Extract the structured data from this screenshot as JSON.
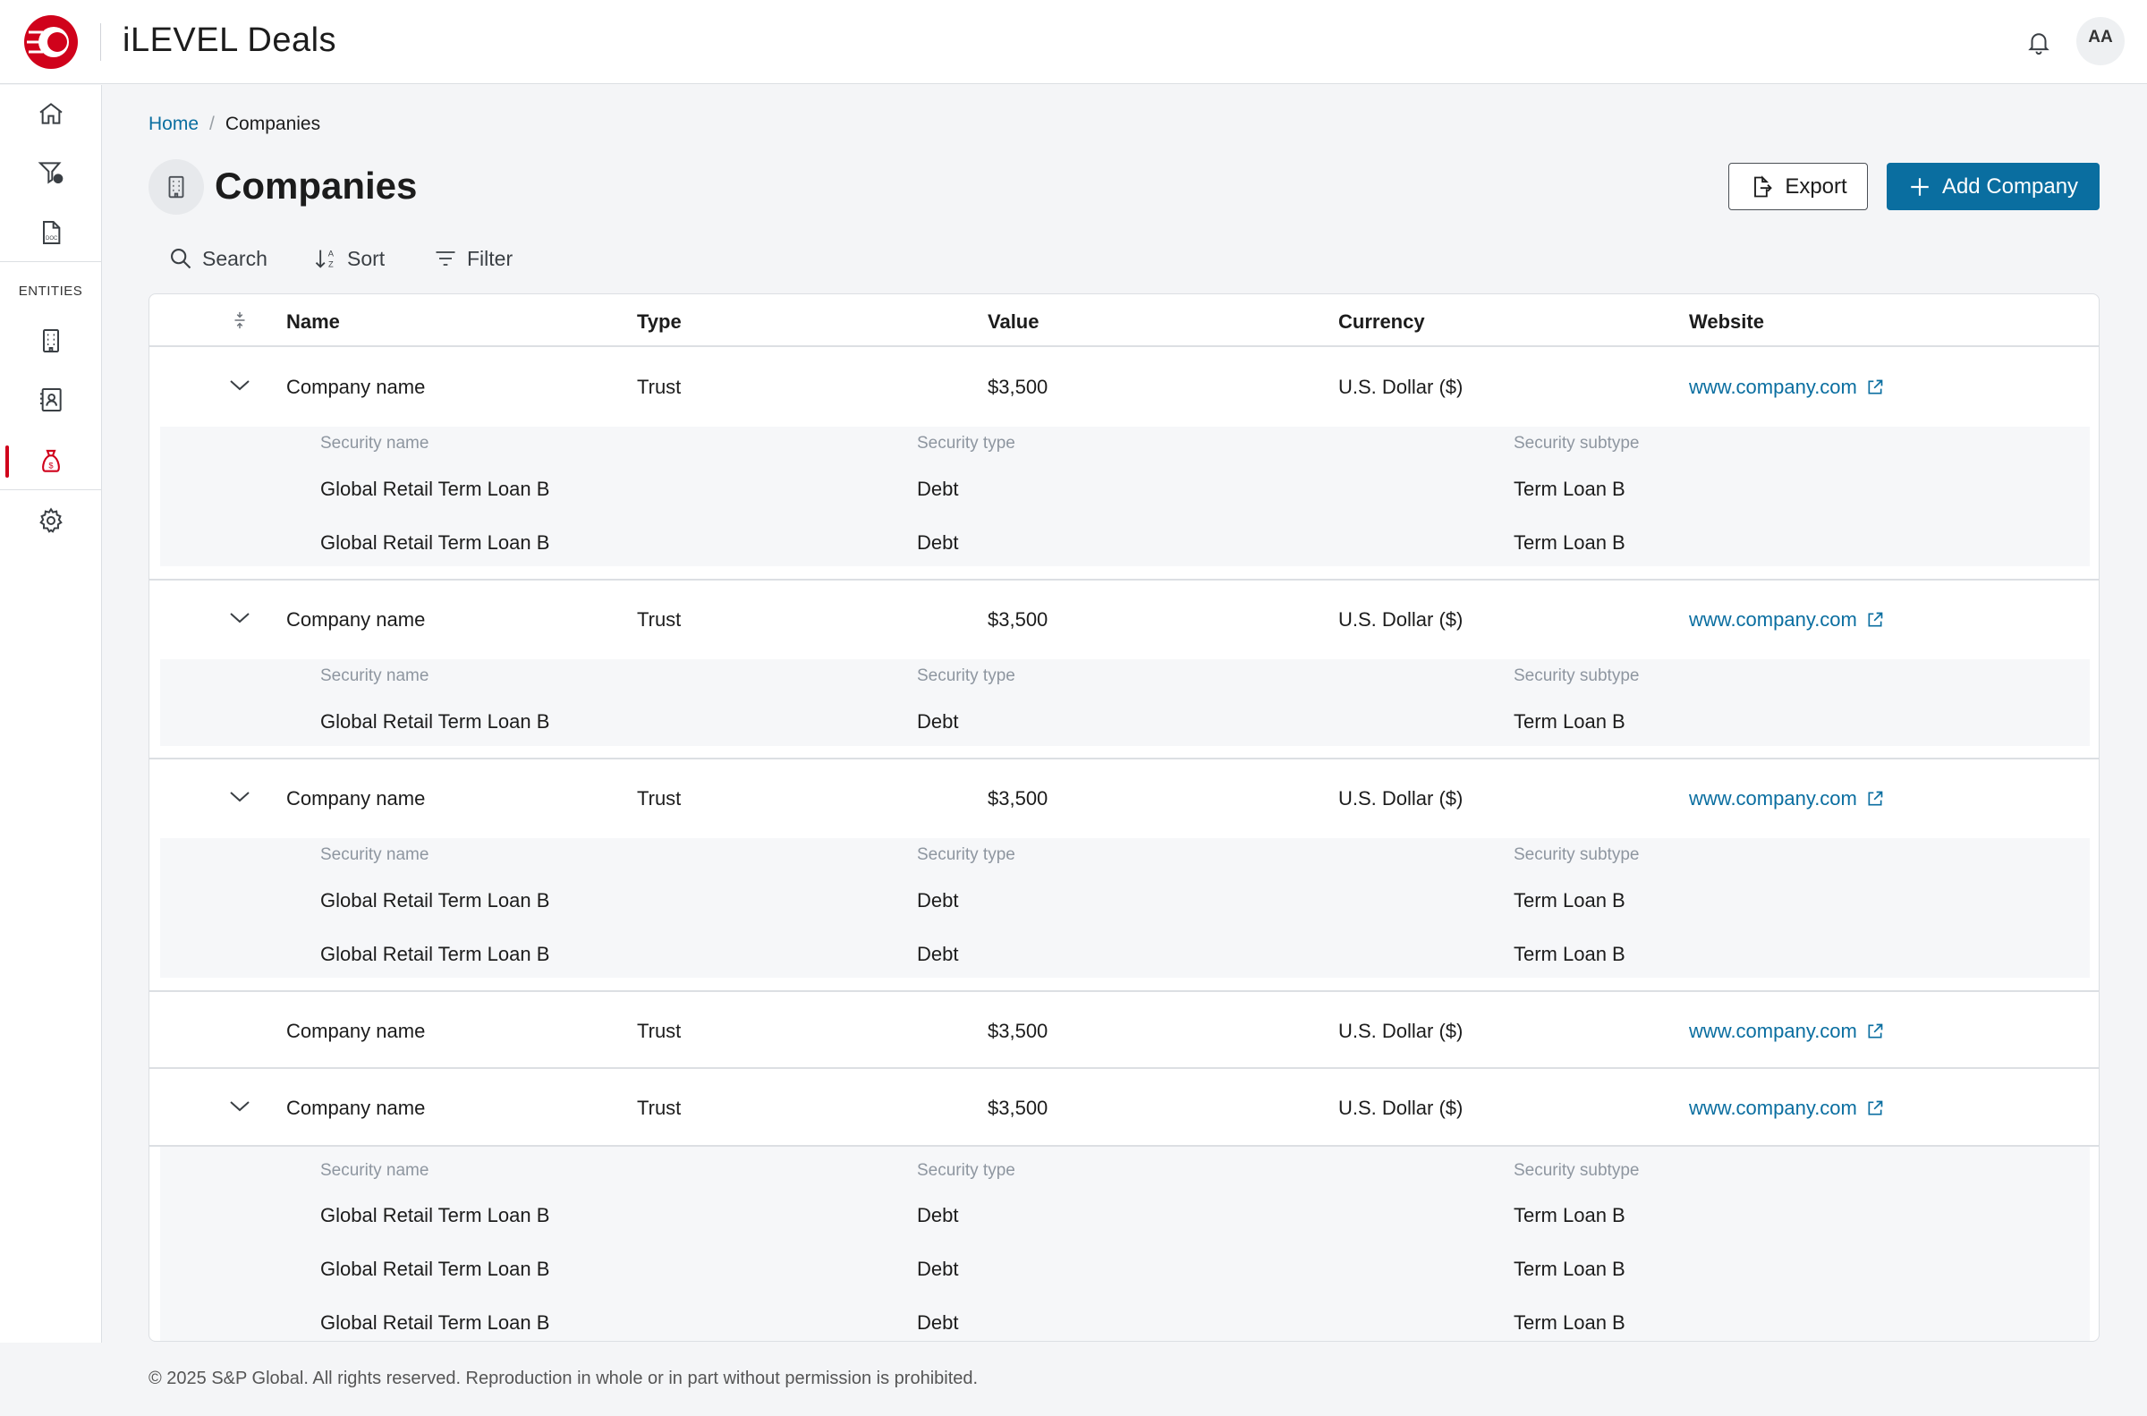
{
  "app": {
    "title": "iLEVEL Deals",
    "avatar_initials": "AA"
  },
  "sidebar": {
    "section_label": "ENTITIES"
  },
  "breadcrumb": {
    "home": "Home",
    "separator": "/",
    "current": "Companies"
  },
  "page": {
    "title": "Companies"
  },
  "actions": {
    "export_label": "Export",
    "add_label": "Add Company"
  },
  "toolbar": {
    "search_label": "Search",
    "sort_label": "Sort",
    "filter_label": "Filter"
  },
  "table": {
    "columns": [
      "Name",
      "Type",
      "Value",
      "Currency",
      "Website"
    ],
    "sub_columns": [
      "Security name",
      "Security type",
      "Security subtype"
    ],
    "rows": [
      {
        "name": "Company name",
        "type": "Trust",
        "value": "$3,500",
        "currency": "U.S. Dollar ($)",
        "website": "www.company.com",
        "securities": [
          {
            "name": "Global Retail Term Loan B",
            "type": "Debt",
            "subtype": "Term Loan B"
          },
          {
            "name": "Global Retail Term Loan B",
            "type": "Debt",
            "subtype": "Term Loan B"
          }
        ]
      },
      {
        "name": "Company name",
        "type": "Trust",
        "value": "$3,500",
        "currency": "U.S. Dollar ($)",
        "website": "www.company.com",
        "securities": [
          {
            "name": "Global Retail Term Loan B",
            "type": "Debt",
            "subtype": "Term Loan B"
          }
        ]
      },
      {
        "name": "Company name",
        "type": "Trust",
        "value": "$3,500",
        "currency": "U.S. Dollar ($)",
        "website": "www.company.com",
        "securities": [
          {
            "name": "Global Retail Term Loan B",
            "type": "Debt",
            "subtype": "Term Loan B"
          },
          {
            "name": "Global Retail Term Loan B",
            "type": "Debt",
            "subtype": "Term Loan B"
          }
        ]
      },
      {
        "name": "Company name",
        "type": "Trust",
        "value": "$3,500",
        "currency": "U.S. Dollar ($)",
        "website": "www.company.com",
        "securities": []
      },
      {
        "name": "Company name",
        "type": "Trust",
        "value": "$3,500",
        "currency": "U.S. Dollar ($)",
        "website": "www.company.com",
        "securities": [
          {
            "name": "Global Retail Term Loan B",
            "type": "Debt",
            "subtype": "Term Loan B"
          },
          {
            "name": "Global Retail Term Loan B",
            "type": "Debt",
            "subtype": "Term Loan B"
          },
          {
            "name": "Global Retail Term Loan B",
            "type": "Debt",
            "subtype": "Term Loan B"
          }
        ]
      }
    ]
  },
  "footer": {
    "copyright": "© 2025 S&P Global. All rights reserved. Reproduction in whole or in part without permission is prohibited."
  },
  "colors": {
    "brand_red": "#d0021b",
    "primary_blue": "#0a6ea0"
  }
}
